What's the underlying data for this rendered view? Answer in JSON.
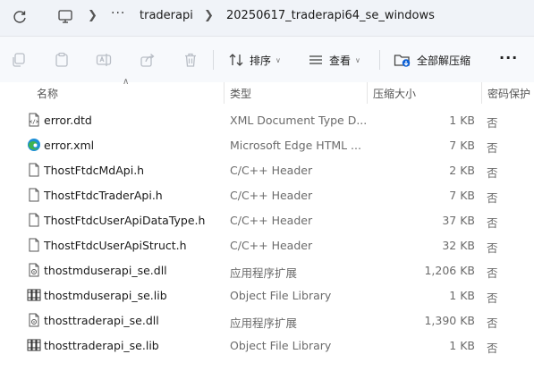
{
  "address": {
    "breadcrumb_parent": "traderapi",
    "breadcrumb_current": "20250617_traderapi64_se_windows",
    "overflow": "···"
  },
  "toolbar": {
    "sort_label": "排序",
    "view_label": "查看",
    "extract_all_label": "全部解压缩",
    "more_label": "···"
  },
  "columns": {
    "name": "名称",
    "type": "类型",
    "compressed_size": "压缩大小",
    "password": "密码保护"
  },
  "files": [
    {
      "name": "error.dtd",
      "type": "XML Document Type D...",
      "size": "1 KB",
      "protected": "否",
      "icon": "dtd-file-icon"
    },
    {
      "name": "error.xml",
      "type": "Microsoft Edge HTML ...",
      "size": "7 KB",
      "protected": "否",
      "icon": "edge-icon"
    },
    {
      "name": "ThostFtdcMdApi.h",
      "type": "C/C++ Header",
      "size": "2 KB",
      "protected": "否",
      "icon": "file-icon"
    },
    {
      "name": "ThostFtdcTraderApi.h",
      "type": "C/C++ Header",
      "size": "7 KB",
      "protected": "否",
      "icon": "file-icon"
    },
    {
      "name": "ThostFtdcUserApiDataType.h",
      "type": "C/C++ Header",
      "size": "37 KB",
      "protected": "否",
      "icon": "file-icon"
    },
    {
      "name": "ThostFtdcUserApiStruct.h",
      "type": "C/C++ Header",
      "size": "32 KB",
      "protected": "否",
      "icon": "file-icon"
    },
    {
      "name": "thostmduserapi_se.dll",
      "type": "应用程序扩展",
      "size": "1,206 KB",
      "protected": "否",
      "icon": "dll-file-icon"
    },
    {
      "name": "thostmduserapi_se.lib",
      "type": "Object File Library",
      "size": "1 KB",
      "protected": "否",
      "icon": "lib-file-icon"
    },
    {
      "name": "thosttraderapi_se.dll",
      "type": "应用程序扩展",
      "size": "1,390 KB",
      "protected": "否",
      "icon": "dll-file-icon"
    },
    {
      "name": "thosttraderapi_se.lib",
      "type": "Object File Library",
      "size": "1 KB",
      "protected": "否",
      "icon": "lib-file-icon"
    }
  ],
  "colors": {
    "accent": "#0a5fd6",
    "edge_blue": "#1d8fd6",
    "edge_green": "#3fb34f"
  }
}
